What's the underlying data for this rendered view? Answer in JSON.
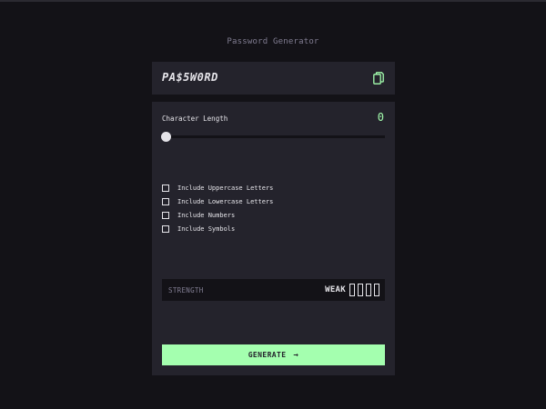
{
  "app": {
    "title": "Password Generator"
  },
  "password": {
    "value": "PA$5W0RD",
    "copy_icon": "copy-icon"
  },
  "length": {
    "label": "Character Length",
    "value": "0"
  },
  "options": [
    {
      "label": "Include Uppercase Letters",
      "checked": false
    },
    {
      "label": "Include Lowercase Letters",
      "checked": false
    },
    {
      "label": "Include Numbers",
      "checked": false
    },
    {
      "label": "Include Symbols",
      "checked": false
    }
  ],
  "strength": {
    "label": "STRENGTH",
    "level": "WEAK",
    "filled_bars": 0,
    "total_bars": 4
  },
  "generate": {
    "label": "GENERATE",
    "icon": "arrow-right-icon"
  },
  "colors": {
    "background": "#131217",
    "panel": "#24232c",
    "accent": "#a4ffaf",
    "text": "#e6e5ea",
    "muted": "#817d92"
  }
}
